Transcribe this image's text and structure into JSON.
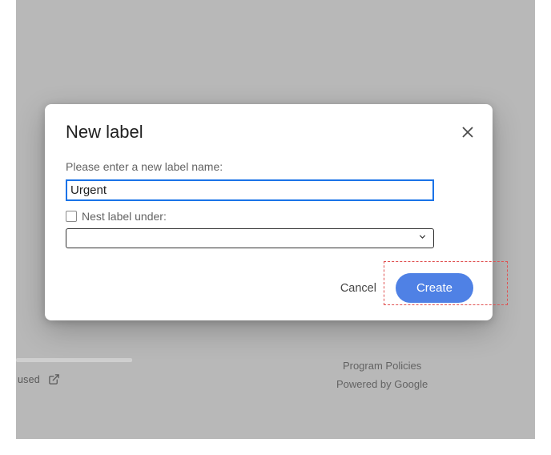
{
  "dialog": {
    "title": "New label",
    "prompt": "Please enter a new label name:",
    "label_name_value": "Urgent",
    "nest_label": "Nest label under:",
    "parent_value": "",
    "cancel_label": "Cancel",
    "create_label": "Create"
  },
  "footer": {
    "storage_used": "used",
    "program_policies": "Program Policies",
    "powered_by": "Powered by Google"
  }
}
